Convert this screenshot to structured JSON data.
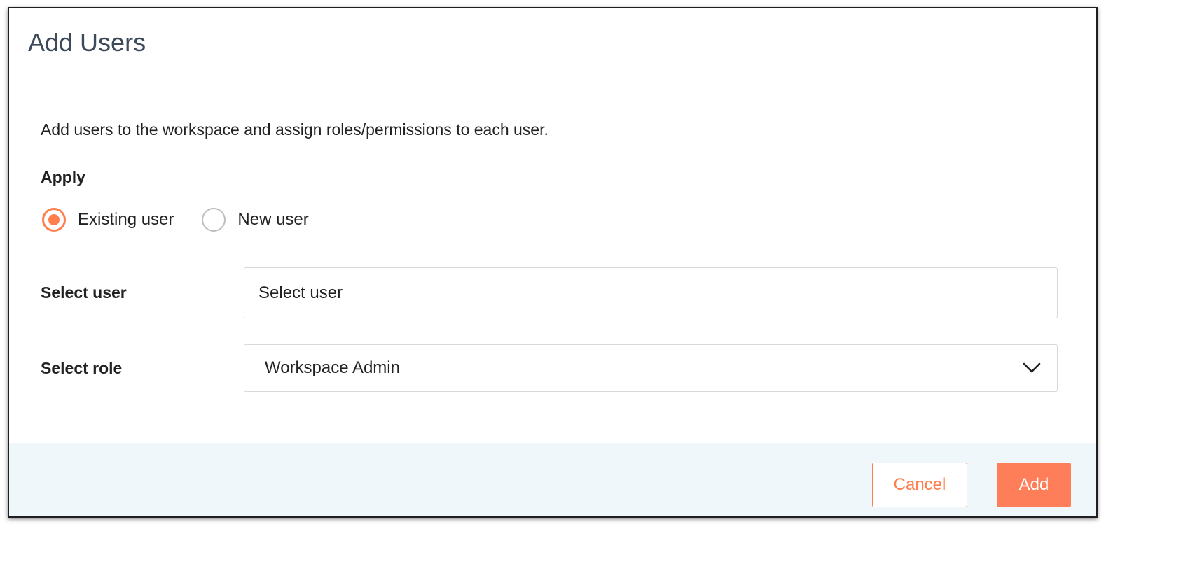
{
  "dialog": {
    "title": "Add Users",
    "description": "Add users to the workspace and assign roles/permissions to each user."
  },
  "apply": {
    "label": "Apply",
    "options": [
      {
        "label": "Existing user",
        "checked": true
      },
      {
        "label": "New user",
        "checked": false
      }
    ]
  },
  "fields": {
    "user": {
      "label": "Select user",
      "placeholder": "Select user"
    },
    "role": {
      "label": "Select role",
      "value": "Workspace Admin"
    }
  },
  "footer": {
    "cancel_label": "Cancel",
    "add_label": "Add"
  },
  "colors": {
    "accent": "#ff7e4d",
    "footer_bg": "#f0f7fb",
    "title_text": "#3c4a5a"
  },
  "icons": {
    "role_dropdown": "chevron-down-icon"
  }
}
